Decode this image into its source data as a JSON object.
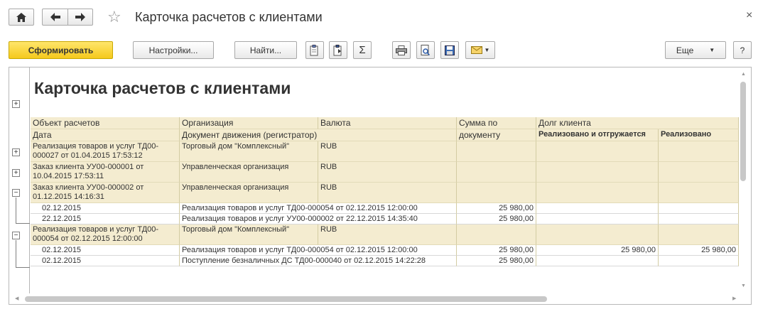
{
  "window": {
    "title": "Карточка расчетов с клиентами",
    "close_label": "×"
  },
  "toolbar": {
    "generate_label": "Сформировать",
    "settings_label": "Настройки...",
    "find_label": "Найти...",
    "more_label": "Еще",
    "help_label": "?"
  },
  "report": {
    "title": "Карточка расчетов с клиентами",
    "headers": {
      "object": "Объект расчетов",
      "organization": "Организация",
      "currency": "Валюта",
      "amount_line1": "Сумма по",
      "amount_line2": "документу",
      "debt": "Долг клиента",
      "date": "Дата",
      "movement_doc": "Документ движения (регистратор)",
      "debt_sub1": "Реализовано и отгружается",
      "debt_sub2": "Реализовано"
    },
    "rows": [
      {
        "object": "Реализация товаров и услуг ТД00-000027 от 01.04.2015 17:53:12",
        "organization": "Торговый дом \"Комплексный\"",
        "currency": "RUB"
      },
      {
        "object": "Заказ клиента УУ00-000001 от 10.04.2015 17:53:11",
        "organization": "Управленческая организация",
        "currency": "RUB"
      },
      {
        "object": "Заказ клиента УУ00-000002 от 01.12.2015 14:16:31",
        "organization": "Управленческая организация",
        "currency": "RUB"
      },
      {
        "date": "02.12.2015",
        "document": "Реализация товаров и услуг ТД00-000054 от 02.12.2015 12:00:00",
        "amount": "25 980,00",
        "debt1": "",
        "debt2": ""
      },
      {
        "date": "22.12.2015",
        "document": "Реализация товаров и услуг УУ00-000002 от 22.12.2015 14:35:40",
        "amount": "25 980,00",
        "debt1": "",
        "debt2": ""
      },
      {
        "object": "Реализация товаров и услуг ТД00-000054 от 02.12.2015 12:00:00",
        "organization": "Торговый дом \"Комплексный\"",
        "currency": "RUB"
      },
      {
        "date": "02.12.2015",
        "document": "Реализация товаров и услуг ТД00-000054 от 02.12.2015 12:00:00",
        "amount": "25 980,00",
        "debt1": "25 980,00",
        "debt2": "25 980,00"
      },
      {
        "date": "02.12.2015",
        "document": "Поступление безналичных ДС ТД00-000040 от 02.12.2015 14:22:28",
        "amount": "25 980,00",
        "debt1": "",
        "debt2": ""
      }
    ]
  },
  "colors": {
    "header_bg": "#f4ecd0",
    "primary_button": "#f5c91c"
  }
}
